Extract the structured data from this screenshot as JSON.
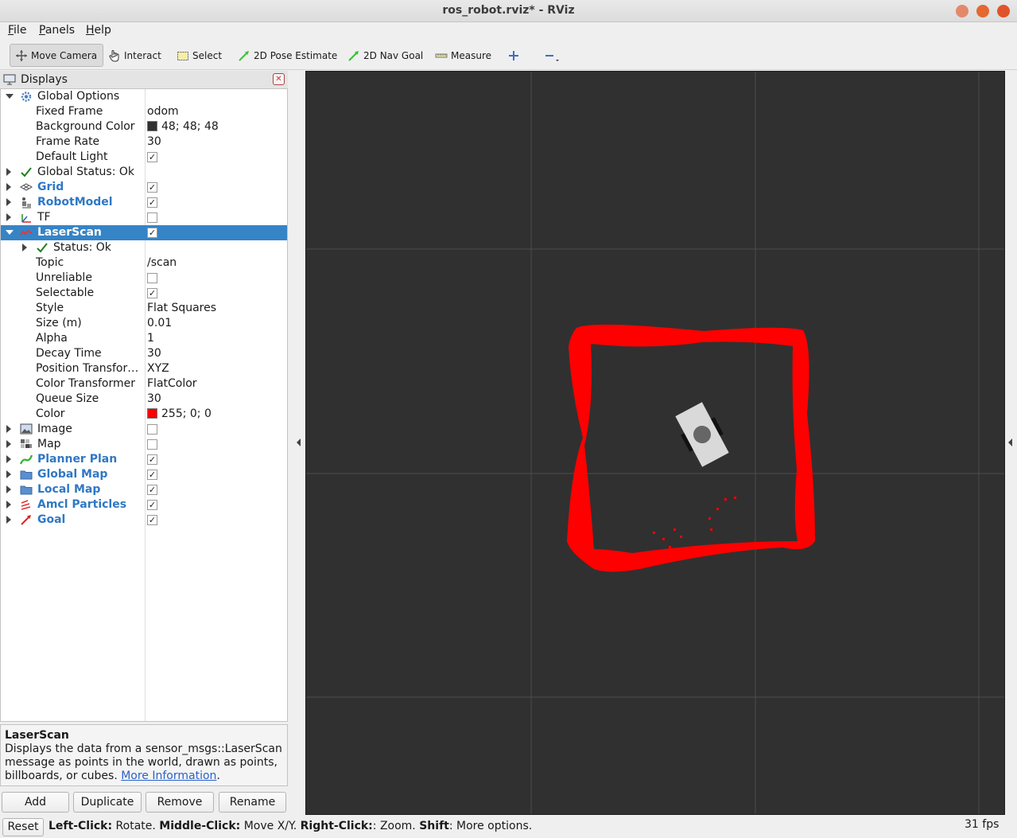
{
  "window": {
    "title": "ros_robot.rviz* - RViz",
    "buttons": [
      "minimize",
      "maximize",
      "close"
    ]
  },
  "menu": [
    {
      "acc": "F",
      "rest": "ile"
    },
    {
      "acc": "P",
      "rest": "anels"
    },
    {
      "acc": "H",
      "rest": "elp"
    }
  ],
  "toolbar": {
    "move_camera": "Move Camera",
    "interact": "Interact",
    "select": "Select",
    "pose_estimate": "2D Pose Estimate",
    "nav_goal": "2D Nav Goal",
    "measure": "Measure"
  },
  "displays": {
    "title": "Displays",
    "rows": [
      {
        "label": "Global Options"
      },
      {
        "label": "Fixed Frame",
        "value": "odom"
      },
      {
        "label": "Background Color",
        "value": "48; 48; 48",
        "swatch": "#303030"
      },
      {
        "label": "Frame Rate",
        "value": "30"
      },
      {
        "label": "Default Light",
        "checked": true
      },
      {
        "label": "Global Status: Ok"
      },
      {
        "label": "Grid",
        "checked": true
      },
      {
        "label": "RobotModel",
        "checked": true
      },
      {
        "label": "TF",
        "checked": false
      },
      {
        "label": "LaserScan",
        "checked": true
      },
      {
        "label": "Status: Ok"
      },
      {
        "label": "Topic",
        "value": "/scan"
      },
      {
        "label": "Unreliable",
        "checked": false
      },
      {
        "label": "Selectable",
        "checked": true
      },
      {
        "label": "Style",
        "value": "Flat Squares"
      },
      {
        "label": "Size (m)",
        "value": "0.01"
      },
      {
        "label": "Alpha",
        "value": "1"
      },
      {
        "label": "Decay Time",
        "value": "30"
      },
      {
        "label": "Position Transfor…",
        "value": "XYZ"
      },
      {
        "label": "Color Transformer",
        "value": "FlatColor"
      },
      {
        "label": "Queue Size",
        "value": "30"
      },
      {
        "label": "Color",
        "value": "255; 0; 0",
        "swatch": "#ff0000"
      },
      {
        "label": "Image",
        "checked": false
      },
      {
        "label": "Map",
        "checked": false
      },
      {
        "label": "Planner Plan",
        "checked": true
      },
      {
        "label": "Global Map",
        "checked": true
      },
      {
        "label": "Local Map",
        "checked": true
      },
      {
        "label": "Amcl Particles",
        "checked": true
      },
      {
        "label": "Goal",
        "checked": true
      }
    ]
  },
  "description": {
    "title": "LaserScan",
    "text": "Displays the data from a sensor_msgs::LaserScan message as points in the world, drawn as points, billboards, or cubes.",
    "link": "More Information"
  },
  "buttons": {
    "add": "Add",
    "duplicate": "Duplicate",
    "remove": "Remove",
    "rename": "Rename"
  },
  "status": {
    "reset": "Reset",
    "help": [
      {
        "b": "Left-Click:",
        "t": " Rotate. "
      },
      {
        "b": "Middle-Click:",
        "t": " Move X/Y. "
      },
      {
        "b": "Right-Click:",
        "t": ": Zoom. "
      },
      {
        "b": "Shift",
        "t": ": More options."
      }
    ],
    "fps": "31 fps"
  },
  "colors": {
    "render_bg": "#303030",
    "selection": "#3584c6",
    "scan": "#ff0000",
    "link_blue": "#2f78c4"
  }
}
